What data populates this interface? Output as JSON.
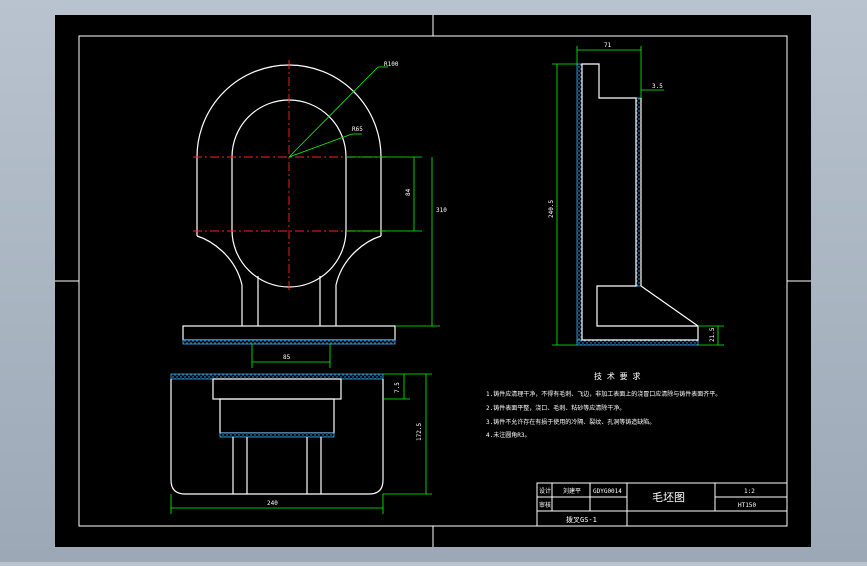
{
  "drawing": {
    "dims": {
      "outer_radius": "R100",
      "inner_radius": "R65",
      "height_84": "84",
      "height_310": "310",
      "width_85": "85",
      "top_width_71": "71",
      "wall_35": "3.5",
      "height_2405": "240.5",
      "base_215": "21.5",
      "bottom_75": "7.5",
      "bottom_1725": "172.5",
      "bottom_width_240": "240"
    },
    "tech_requirements": {
      "title": "技 术 要 求",
      "items": [
        "1.铸件应清理干净，不得有毛刺、飞边，非加工表面上的浇冒口应清除与铸件表面齐平。",
        "2.铸件表面平整，浇口、毛刺、粘砂等应清除干净。",
        "3.铸件不允许存在有损于使用的冷隔、裂纹、孔洞等铸造缺陷。",
        "4.未注圆角R3。"
      ]
    },
    "title_block": {
      "role_design": "设计",
      "name_design": "刘建平",
      "drawing_no": "GDYG0014",
      "role_check": "审核",
      "title": "毛坯图",
      "scale": "1:2",
      "material": "HT150",
      "part_name": "拨叉GS-1"
    },
    "colors": {
      "background": "#000000",
      "outline": "#ffffff",
      "dimension": "#00ff00",
      "centerline": "#ff0000",
      "machining_allowance": "#1aa0e0"
    }
  }
}
